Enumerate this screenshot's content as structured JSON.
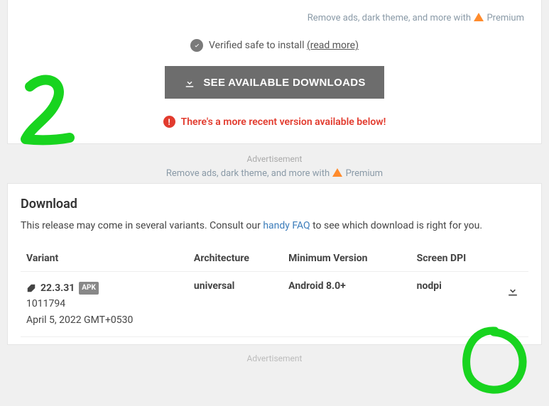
{
  "top_card": {
    "premium_prefix": "Remove ads, dark theme, and more with ",
    "premium_word": "Premium",
    "verified_prefix": "Verified safe to install ",
    "verified_suffix": "(read more)",
    "download_btn": "SEE AVAILABLE DOWNLOADS",
    "warning": "There's a more recent version available below!"
  },
  "ad": {
    "label": "Advertisement",
    "premium_prefix": "Remove ads, dark theme, and more with ",
    "premium_word": "Premium"
  },
  "download_card": {
    "heading": "Download",
    "desc_prefix": "This release may come in several variants. Consult our ",
    "faq_link": "handy FAQ",
    "desc_suffix": " to see which download is right for you.",
    "headers": {
      "variant": "Variant",
      "architecture": "Architecture",
      "min_version": "Minimum Version",
      "screen_dpi": "Screen DPI"
    },
    "row": {
      "version": "22.3.31",
      "apk_badge": "APK",
      "build_id": "1011794",
      "date": "April 5, 2022 GMT+0530",
      "architecture": "universal",
      "min_version": "Android 8.0+",
      "screen_dpi": "nodpi"
    }
  },
  "footer": "Advertisement"
}
